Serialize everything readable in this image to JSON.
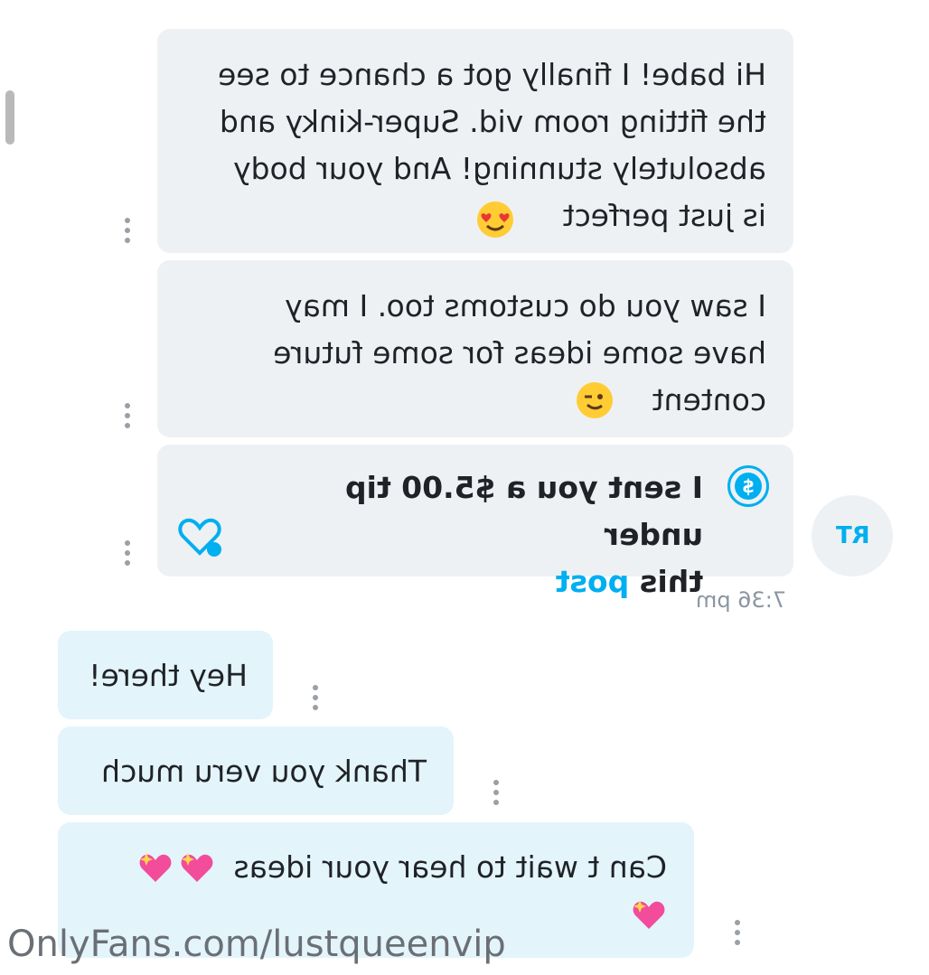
{
  "messages_in": [
    {
      "text": "Hi babe! I finally got a chance to see\nthe fitting room vid. Super-kinky and\nabsolutely stunning! And your body\nis just perfect",
      "emoji": "heart-eyes-emoji"
    },
    {
      "text": "I saw you do customs too. I may\nhave some ideas for some future\ncontent",
      "emoji": "wink-emoji"
    }
  ],
  "tip_message": {
    "text_before": "I sent you a $5.00 tip under\nthis ",
    "link": "post",
    "icon": "dollar-icon",
    "icon_glyph": "$",
    "like_icon": "heart-plus-icon"
  },
  "avatar": {
    "initials": "RT"
  },
  "timestamp": "7:36 pm",
  "messages_out": [
    {
      "text": "Hey there!"
    },
    {
      "text": "Thank you veru much"
    },
    {
      "text": "Can t wait to hear your ideas",
      "emoji": "sparkling-heart-emoji"
    }
  ],
  "watermark": "OnlyFans.com/lustqueenvip",
  "colors": {
    "accent": "#00aff0",
    "incoming_bubble": "#eef1f3",
    "outgoing_bubble": "#e3f4fb"
  }
}
